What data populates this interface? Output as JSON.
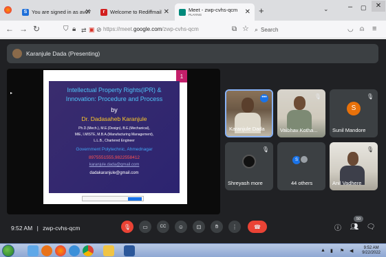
{
  "browser": {
    "tabs": [
      {
        "title": "You are signed in as av07201...",
        "close": "✕"
      },
      {
        "title": "Welcome to Rediffmail",
        "close": "✕"
      },
      {
        "title": "Meet - zwp-cvhs-qcm",
        "subtitle": "PLAYING",
        "close": "✕"
      }
    ],
    "new_tab": "+",
    "url_prefix": "https://meet.",
    "url_domain": "google.com",
    "url_path": "/zwp-cvhs-qcm",
    "search_placeholder": "Search",
    "colors": {
      "tabstrip": "#dcdde0",
      "toolbar": "#f6f6f8"
    }
  },
  "meet": {
    "presenting_label": "Karanjule Dada (Presenting)",
    "slide": {
      "page_badge": "1",
      "title_line1": "Intellectual Property Rights(IPR) &",
      "title_line2": "Innovation: Procedure and Process",
      "by": "by",
      "author": "Dr. Dadasaheb Karanjule",
      "quals1": "Ph.D.(Mech.), M.E.(Design), B.E.(Mechanical),",
      "quals2": "MIE, I.MISTE, M.B.A.(Manufacturing Management),",
      "quals3": "L.L.B., Chartered Engineer",
      "org": "Government Polytechnic, Ahmednagar",
      "phones": "8975551555,9822558412",
      "email1": "karanjule.dada@gmail.com",
      "email2": "dadakaranjule@gmail.com"
    },
    "participants": [
      {
        "name": "Karanjule Dada"
      },
      {
        "name": "Vaibhav Kotha..."
      },
      {
        "name": "Sunil Mandore",
        "initial": "S"
      },
      {
        "name": "Shreyash more"
      },
      {
        "name": "44 others",
        "initial": "S"
      },
      {
        "name": "Anil Vadhere"
      }
    ],
    "time": "9:52 AM",
    "separator": "|",
    "meeting_code": "zwp-cvhs-qcm",
    "people_count": "50",
    "accent": "#ea4335"
  },
  "taskbar": {
    "time": "9:52 AM",
    "date": "9/22/2022"
  }
}
